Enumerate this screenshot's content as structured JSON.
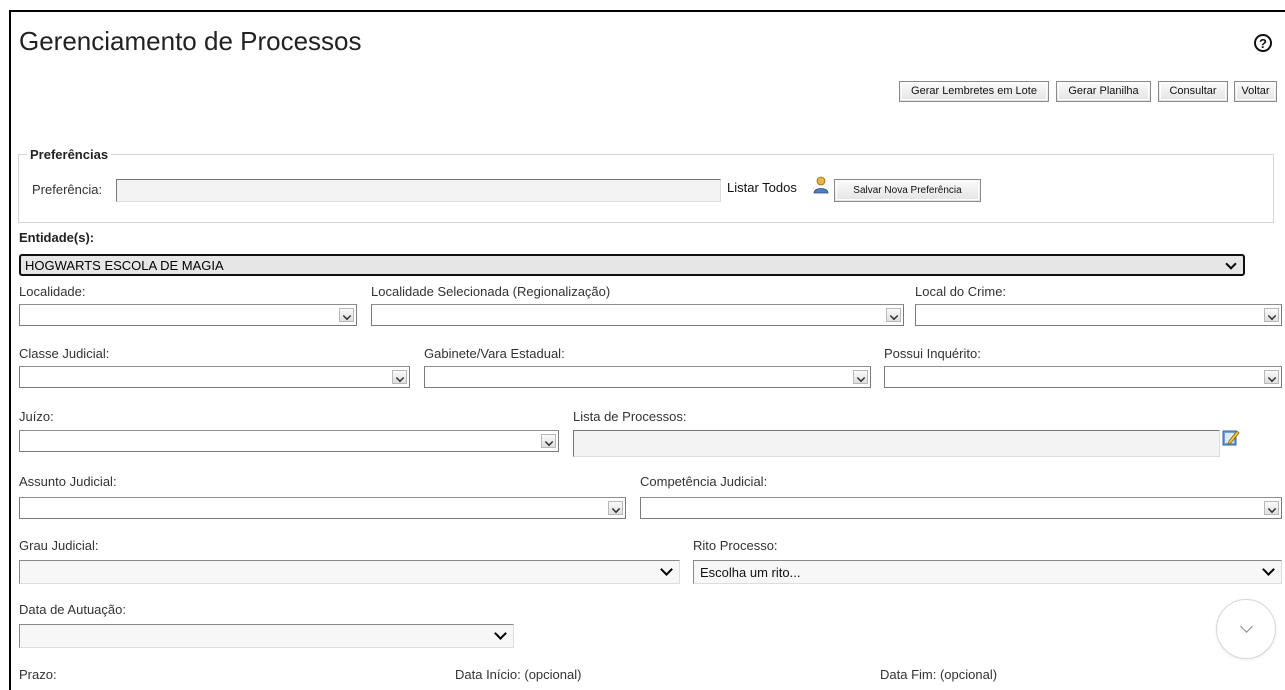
{
  "page": {
    "title": "Gerenciamento de Processos",
    "help_glyph": "?"
  },
  "toolbar": {
    "buttons": [
      "Gerar Lembretes em Lote",
      "Gerar Planilha",
      "Consultar",
      "Voltar"
    ]
  },
  "preferences": {
    "legend": "Preferências",
    "label": "Preferência:",
    "value": "",
    "list_all": "Listar Todos",
    "save_button": "Salvar Nova Preferência"
  },
  "entities": {
    "label": "Entidade(s):",
    "selected": "HOGWARTS ESCOLA DE MAGIA"
  },
  "fields": {
    "localidade": "Localidade:",
    "localidade_selecionada": "Localidade Selecionada (Regionalização)",
    "local_crime": "Local do Crime:",
    "classe_judicial": "Classe Judicial:",
    "gabinete": "Gabinete/Vara Estadual:",
    "possui_inquerito": "Possui Inquérito:",
    "juizo": "Juízo:",
    "lista_processos": "Lista de Processos:",
    "assunto_judicial": "Assunto Judicial:",
    "competencia_judicial": "Competência Judicial:",
    "grau_judicial": "Grau Judicial:",
    "rito_processo": "Rito Processo:",
    "rito_value": "Escolha um rito...",
    "data_autuacao": "Data de Autuação:",
    "prazo": "Prazo:",
    "data_inicio": "Data Início: (opcional)",
    "data_fim": "Data Fim: (opcional)"
  },
  "colors": {
    "accent_person": "#d9a441",
    "edit_icon": "#3a6fc4"
  }
}
